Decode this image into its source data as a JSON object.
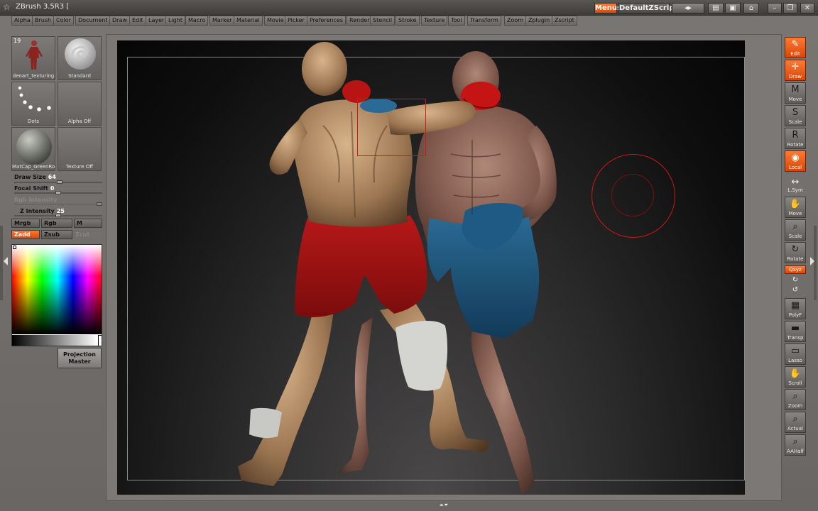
{
  "app": {
    "title": "ZBrush 3.5R3  [",
    "menus_button": "Menus",
    "zscript_button": "DefaultZScript"
  },
  "menubar": [
    "Alpha",
    "Brush",
    "Color",
    "Document",
    "Draw",
    "Edit",
    "Layer",
    "Light",
    "Macro",
    "Marker",
    "Material",
    "Movie",
    "Picker",
    "Preferences",
    "Render",
    "Stencil",
    "Stroke",
    "Texture",
    "Tool",
    "Transform",
    "Zoom",
    "Zplugin",
    "Zscript"
  ],
  "left_panel": {
    "thumbs": {
      "tool": {
        "label": "deoart_texturing",
        "count": "19"
      },
      "brush": {
        "label": "Standard"
      },
      "stroke": {
        "label": "Dots"
      },
      "alpha": {
        "label": "Alpha  Off"
      },
      "material": {
        "label": "MatCap_GreenRo"
      },
      "texture": {
        "label": "Texture  Off"
      }
    },
    "draw_size": {
      "label": "Draw  Size",
      "value": "64",
      "fraction": 0.52
    },
    "focal_shift": {
      "label": "Focal  Shift",
      "value": "0",
      "fraction": 0.5
    },
    "rgb_intensity": {
      "label": "Rgb  Intensity",
      "fraction": 1.0
    },
    "z_intensity": {
      "label": "Z  Intensity",
      "value": "25",
      "fraction": 0.5
    },
    "color_modes": {
      "mrgb": "Mrgb",
      "rgb": "Rgb",
      "m": "M"
    },
    "sculpt_modes": {
      "zadd": "Zadd",
      "zsub": "Zsub",
      "zcut": "Zcut"
    },
    "projection_master": {
      "line1": "Projection",
      "line2": "Master"
    }
  },
  "right_toolbar": {
    "edit": "Edit",
    "draw": "Draw",
    "move": "Move",
    "scale": "Scale",
    "rotate": "Rotate",
    "local": "Local",
    "lsym": "L.Sym",
    "move2": "Move",
    "scale2": "Scale",
    "rotate2": "Rotate",
    "xyz": "Qxyz",
    "polyf": "PolyF",
    "transp": "Transp",
    "lasso": "Lasso",
    "scroll": "Scroll",
    "zoom": "Zoom",
    "actual": "Actual",
    "aahalf": "AAHalf"
  },
  "icons": {
    "edit_glyph": "✎",
    "draw_glyph": "✛",
    "move_glyph": "M",
    "scale_glyph": "S",
    "rotate_glyph": "R",
    "local_glyph": "◉",
    "lsym_glyph": "↔",
    "hand_glyph": "✋",
    "magnifier_glyph": "⌕",
    "grid_glyph": "▦",
    "transp_glyph": "▬",
    "lasso_glyph": "▭",
    "rotate_small_1": "↻",
    "rotate_small_2": "↺"
  },
  "colors": {
    "accent": "#e85a18",
    "selection": "#d01818"
  }
}
